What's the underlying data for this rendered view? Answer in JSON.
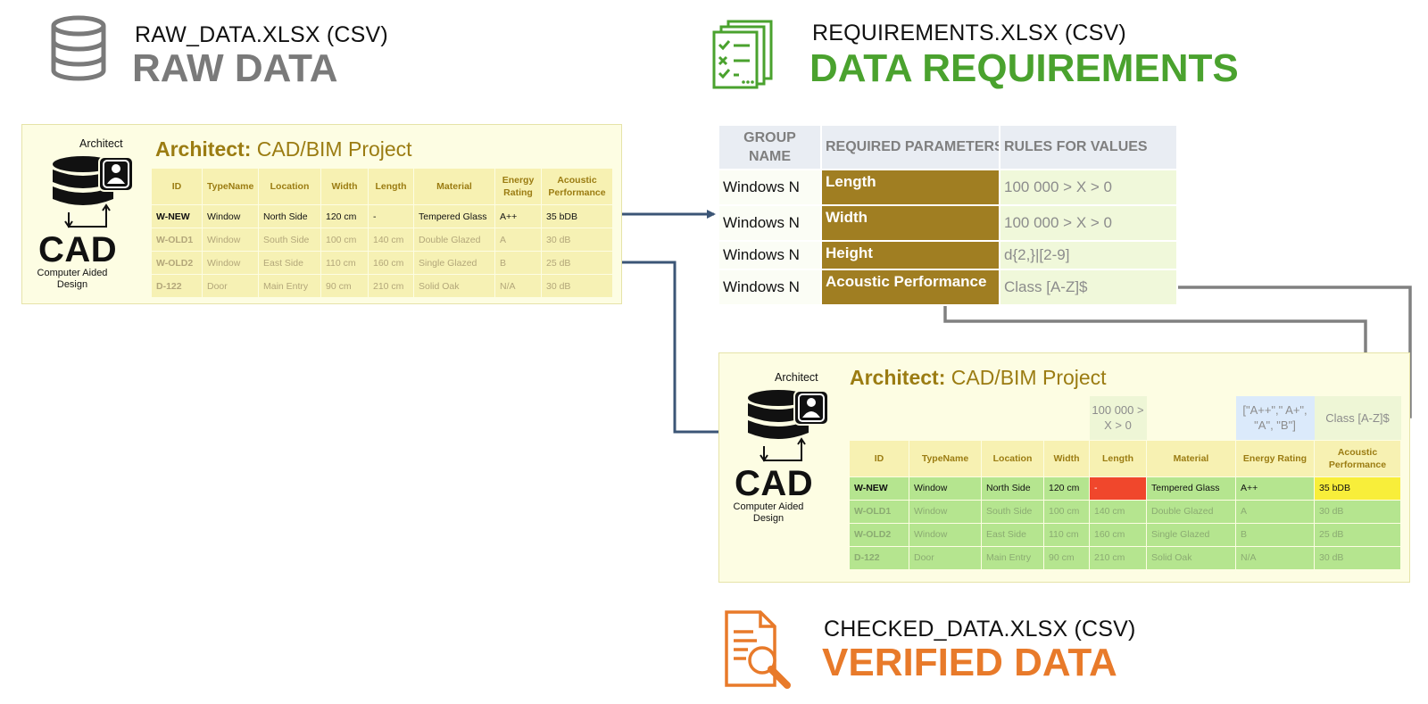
{
  "raw_section": {
    "file": "RAW_DATA.XLSX (CSV)",
    "title": "RAW DATA",
    "title_color": "#7a7a7a",
    "icon": "database-icon"
  },
  "requirements_section": {
    "file": "REQUIREMENTS.XLSX (CSV)",
    "title": "DATA REQUIREMENTS",
    "title_color": "#4aa22e",
    "icon": "checklist-icon"
  },
  "checked_section": {
    "file": "CHECKED_DATA.XLSX (CSV)",
    "title": "VERIFIED DATA",
    "title_color": "#e87a2a",
    "icon": "document-search-icon"
  },
  "raw_panel": {
    "role_label": "Architect",
    "project_bold": "Architect:",
    "project_rest": " CAD/BIM Project",
    "cad_word": "CAD",
    "cad_sub": "Computer Aided Design"
  },
  "verified_panel": {
    "role_label": "Architect",
    "project_bold": "Architect:",
    "project_rest": " CAD/BIM Project",
    "cad_word": "CAD",
    "cad_sub": "Computer Aided Design",
    "rules": {
      "length": "100 000 > X > 0",
      "energy": "[\"A++\",\" A+\", \"A\", \"B\"]",
      "acoustic": "Class [A-Z]$"
    }
  },
  "table": {
    "headers": [
      "ID",
      "TypeName",
      "Location",
      "Width",
      "Length",
      "Material",
      "Energy Rating",
      "Acoustic Performance"
    ],
    "rows": [
      [
        "W-NEW",
        "Window",
        "North Side",
        "120 cm",
        "-",
        "Tempered Glass",
        "A++",
        "35 bDB"
      ],
      [
        "W-OLD1",
        "Window",
        "South Side",
        "100 cm",
        "140 cm",
        "Double Glazed",
        "A",
        "30 dB"
      ],
      [
        "W-OLD2",
        "Window",
        "East Side",
        "110 cm",
        "160 cm",
        "Single Glazed",
        "B",
        "25 dB"
      ],
      [
        "D-122",
        "Door",
        "Main Entry",
        "90 cm",
        "210 cm",
        "Solid Oak",
        "N/A",
        "30 dB"
      ]
    ]
  },
  "requirements_table": {
    "headers": [
      "GROUP NAME",
      "REQUIRED PARAMETERS",
      "RULES FOR VALUES"
    ],
    "rows": [
      [
        "Windows N",
        "Length",
        "100 000 > X > 0"
      ],
      [
        "Windows N",
        "Width",
        "100 000 > X > 0"
      ],
      [
        "Windows N",
        "Height",
        "d{2,}|[2-9]"
      ],
      [
        "Windows N",
        "Acoustic Performance",
        "Class [A-Z]$"
      ]
    ]
  },
  "colors": {
    "raw_connector": "#3b5576",
    "rule_connector": "#808080",
    "valid_cell": "#b5e58f",
    "error_cell": "#f0472c",
    "warning_cell": "#f8ee3a",
    "parameter_cell": "#a07e22"
  }
}
